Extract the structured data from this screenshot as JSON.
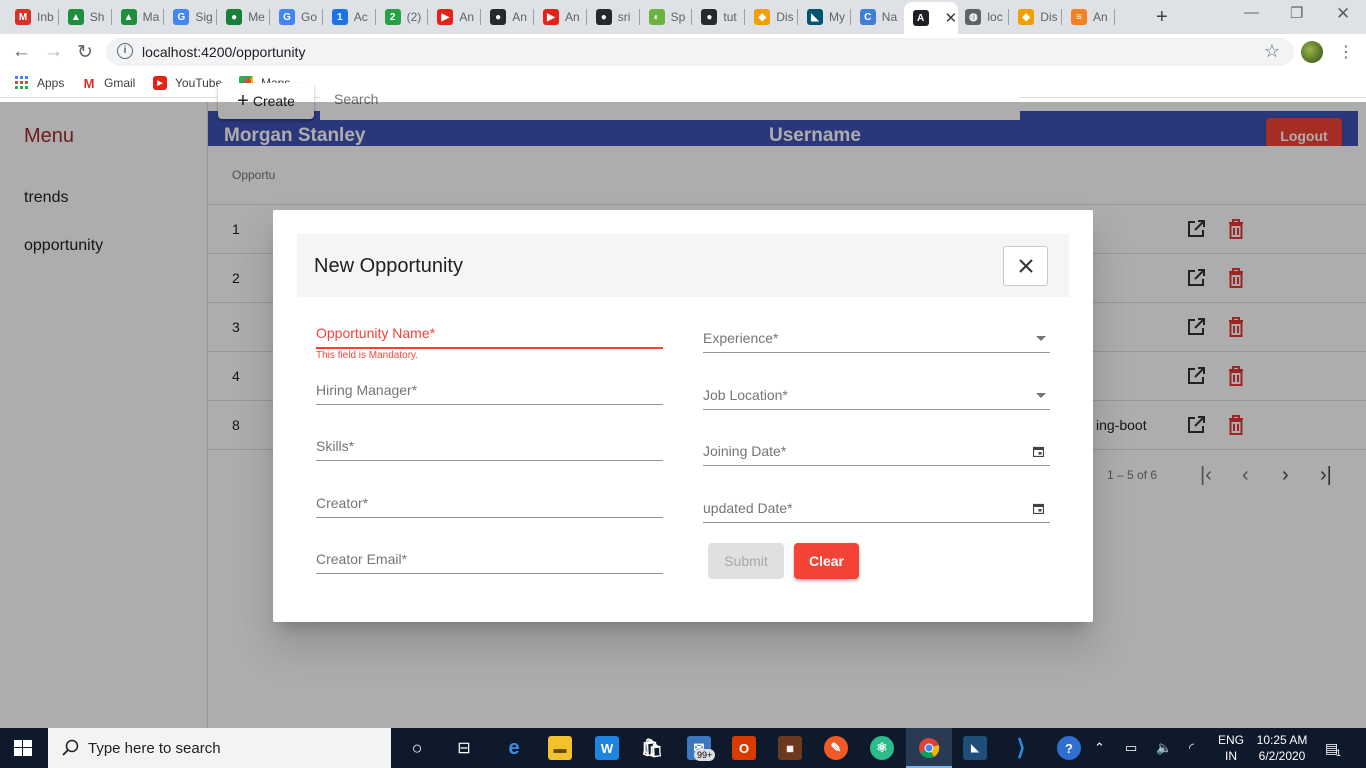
{
  "browser": {
    "tabs": [
      {
        "label": "Inb",
        "icon": "gmail-icon",
        "color": "#d93025",
        "glyph": "M"
      },
      {
        "label": "Sh",
        "icon": "drive-icon",
        "color": "#1e8e3e",
        "glyph": "▲"
      },
      {
        "label": "Ma",
        "icon": "drive-icon",
        "color": "#1e8e3e",
        "glyph": "▲"
      },
      {
        "label": "Sig",
        "icon": "google-icon",
        "color": "#4285f4",
        "glyph": "G"
      },
      {
        "label": "Me",
        "icon": "messages-icon",
        "color": "#188038",
        "glyph": "●"
      },
      {
        "label": "Go",
        "icon": "google-icon",
        "color": "#4285f4",
        "glyph": "G"
      },
      {
        "label": "Ac",
        "icon": "calendar-icon",
        "color": "#1a73e8",
        "glyph": "1"
      },
      {
        "label": "(2)",
        "icon": "whatsapp-icon",
        "color": "#25a244",
        "glyph": "2"
      },
      {
        "label": "An",
        "icon": "youtube-icon",
        "color": "#e62117",
        "glyph": "▶"
      },
      {
        "label": "An",
        "icon": "github-icon",
        "color": "#24292e",
        "glyph": "●"
      },
      {
        "label": "An",
        "icon": "youtube-icon",
        "color": "#e62117",
        "glyph": "▶"
      },
      {
        "label": "sri",
        "icon": "github-icon",
        "color": "#24292e",
        "glyph": "●"
      },
      {
        "label": "Sp",
        "icon": "spring-icon",
        "color": "#6db33f",
        "glyph": "◐"
      },
      {
        "label": "tut",
        "icon": "github-icon",
        "color": "#24292e",
        "glyph": "●"
      },
      {
        "label": "Dis",
        "icon": "shield-icon",
        "color": "#f29f05",
        "glyph": "◆"
      },
      {
        "label": "My",
        "icon": "mysql-icon",
        "color": "#00546b",
        "glyph": "◣"
      },
      {
        "label": "Na",
        "icon": "c-icon",
        "color": "#3f7fd6",
        "glyph": "C"
      },
      {
        "label": "",
        "icon": "angular-icon",
        "color": "#202124",
        "glyph": "A",
        "active": true
      },
      {
        "label": "loc",
        "icon": "globe-icon",
        "color": "#5f6368",
        "glyph": "◍"
      },
      {
        "label": "Dis",
        "icon": "shield-icon",
        "color": "#f29f05",
        "glyph": "◆"
      },
      {
        "label": "An",
        "icon": "stackoverflow-icon",
        "color": "#f48024",
        "glyph": "≡"
      }
    ],
    "url": "localhost:4200/opportunity",
    "bookmarks": [
      {
        "label": "Apps",
        "icon": "apps-grid-icon"
      },
      {
        "label": "Gmail",
        "icon": "gmail-icon"
      },
      {
        "label": "YouTube",
        "icon": "youtube-icon"
      },
      {
        "label": "Maps",
        "icon": "maps-icon"
      }
    ]
  },
  "sidebar": {
    "title": "Menu",
    "items": [
      {
        "label": "trends"
      },
      {
        "label": "opportunity"
      }
    ]
  },
  "header": {
    "brand": "Morgan Stanley",
    "username": "Username",
    "logout_label": "Logout"
  },
  "toolbar": {
    "create_label": "Create",
    "search_placeholder": "Search"
  },
  "table": {
    "header_partial": "Opportu",
    "rows": [
      {
        "id": "1",
        "tail": ""
      },
      {
        "id": "2",
        "tail": ""
      },
      {
        "id": "3",
        "tail": ""
      },
      {
        "id": "4",
        "tail": ""
      },
      {
        "id": "8",
        "tail": "ing-boot"
      }
    ],
    "paginator_range": "1 – 5 of 6"
  },
  "dialog": {
    "title": "New Opportunity",
    "left_fields": [
      {
        "label": "Opportunity Name*",
        "error": true
      },
      {
        "label": "Hiring Manager*"
      },
      {
        "label": "Skills*"
      },
      {
        "label": "Creator*"
      },
      {
        "label": "Creator Email*"
      }
    ],
    "error_message": "This field is Mandatory.",
    "right_fields": [
      {
        "label": "Experience*",
        "kind": "select"
      },
      {
        "label": "Job Location*",
        "kind": "select"
      },
      {
        "label": "Joining Date*",
        "kind": "date"
      },
      {
        "label": "updated Date*",
        "kind": "date"
      }
    ],
    "submit_label": "Submit",
    "clear_label": "Clear"
  },
  "taskbar": {
    "search_placeholder": "Type here to search",
    "mail_badge": "99+",
    "language_line1": "ENG",
    "language_line2": "IN",
    "time": "10:25 AM",
    "date": "6/2/2020",
    "notification_count": "1"
  },
  "colors": {
    "primary": "#3f51b5",
    "warn": "#f44336",
    "menu_title": "#a42a2a"
  }
}
